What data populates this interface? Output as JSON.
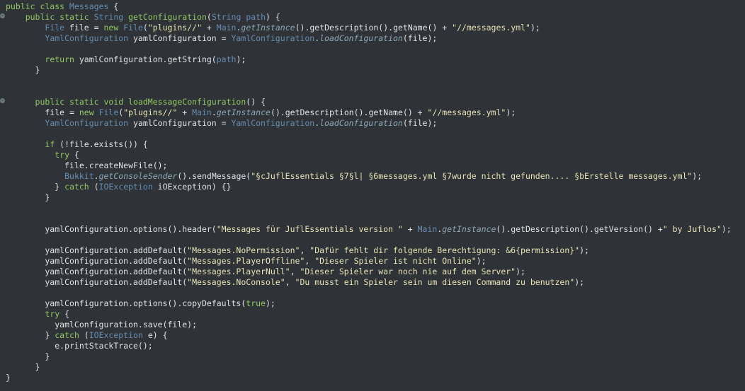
{
  "code_lines": [
    {
      "segments": [
        {
          "c": "k",
          "t": "public class "
        },
        {
          "c": "t",
          "t": "Messages"
        },
        {
          "c": "plain",
          "t": " {"
        }
      ]
    },
    {
      "segments": [
        {
          "c": "plain",
          "t": "    "
        },
        {
          "c": "k",
          "t": "public static "
        },
        {
          "c": "t",
          "t": "String"
        },
        {
          "c": "plain",
          "t": " "
        },
        {
          "c": "green",
          "t": "getConfiguration"
        },
        {
          "c": "plain",
          "t": "("
        },
        {
          "c": "t",
          "t": "String"
        },
        {
          "c": "plain",
          "t": " "
        },
        {
          "c": "cls",
          "t": "path"
        },
        {
          "c": "plain",
          "t": ") {"
        }
      ]
    },
    {
      "segments": [
        {
          "c": "plain",
          "t": "        "
        },
        {
          "c": "t",
          "t": "File"
        },
        {
          "c": "plain",
          "t": " file = "
        },
        {
          "c": "k",
          "t": "new "
        },
        {
          "c": "t",
          "t": "File"
        },
        {
          "c": "plain",
          "t": "("
        },
        {
          "c": "str-c",
          "t": "\"plugins//\""
        },
        {
          "c": "plain",
          "t": " + "
        },
        {
          "c": "t",
          "t": "Main"
        },
        {
          "c": "plain",
          "t": "."
        },
        {
          "c": "i",
          "t": "getInstance"
        },
        {
          "c": "plain",
          "t": "().getDescription().getName() + "
        },
        {
          "c": "str-c",
          "t": "\"//messages.yml\""
        },
        {
          "c": "plain",
          "t": ");"
        }
      ]
    },
    {
      "segments": [
        {
          "c": "plain",
          "t": "        "
        },
        {
          "c": "t",
          "t": "YamlConfiguration"
        },
        {
          "c": "plain",
          "t": " yamlConfiguration = "
        },
        {
          "c": "t",
          "t": "YamlConfiguration"
        },
        {
          "c": "plain",
          "t": "."
        },
        {
          "c": "i",
          "t": "loadConfiguration"
        },
        {
          "c": "plain",
          "t": "(file);"
        }
      ]
    },
    {
      "segments": []
    },
    {
      "segments": [
        {
          "c": "plain",
          "t": "        "
        },
        {
          "c": "k",
          "t": "return "
        },
        {
          "c": "plain",
          "t": "yamlConfiguration.getString("
        },
        {
          "c": "cls",
          "t": "path"
        },
        {
          "c": "plain",
          "t": ");"
        }
      ]
    },
    {
      "segments": [
        {
          "c": "plain",
          "t": "      }"
        }
      ]
    },
    {
      "segments": []
    },
    {
      "segments": []
    },
    {
      "segments": [
        {
          "c": "plain",
          "t": "      "
        },
        {
          "c": "k",
          "t": "public static void "
        },
        {
          "c": "green",
          "t": "loadMessageConfiguration"
        },
        {
          "c": "plain",
          "t": "() {"
        }
      ]
    },
    {
      "segments": [
        {
          "c": "plain",
          "t": "        "
        },
        {
          "c": "plain",
          "t": "file = "
        },
        {
          "c": "k",
          "t": "new "
        },
        {
          "c": "t",
          "t": "File"
        },
        {
          "c": "plain",
          "t": "("
        },
        {
          "c": "str-c",
          "t": "\"plugins//\""
        },
        {
          "c": "plain",
          "t": " + "
        },
        {
          "c": "t",
          "t": "Main"
        },
        {
          "c": "plain",
          "t": "."
        },
        {
          "c": "i",
          "t": "getInstance"
        },
        {
          "c": "plain",
          "t": "().getDescription().getName() + "
        },
        {
          "c": "str-c",
          "t": "\"//messages.yml\""
        },
        {
          "c": "plain",
          "t": ");"
        }
      ]
    },
    {
      "segments": [
        {
          "c": "plain",
          "t": "        "
        },
        {
          "c": "t",
          "t": "YamlConfiguration"
        },
        {
          "c": "plain",
          "t": " yamlConfiguration = "
        },
        {
          "c": "t",
          "t": "YamlConfiguration"
        },
        {
          "c": "plain",
          "t": "."
        },
        {
          "c": "i",
          "t": "loadConfiguration"
        },
        {
          "c": "plain",
          "t": "(file);"
        }
      ]
    },
    {
      "segments": []
    },
    {
      "segments": [
        {
          "c": "plain",
          "t": "        "
        },
        {
          "c": "k",
          "t": "if "
        },
        {
          "c": "plain",
          "t": "(!file.exists()) {"
        }
      ]
    },
    {
      "segments": [
        {
          "c": "plain",
          "t": "          "
        },
        {
          "c": "k",
          "t": "try "
        },
        {
          "c": "plain",
          "t": "{"
        }
      ]
    },
    {
      "segments": [
        {
          "c": "plain",
          "t": "            file.createNewFile();"
        }
      ]
    },
    {
      "segments": [
        {
          "c": "plain",
          "t": "            "
        },
        {
          "c": "t",
          "t": "Bukkit"
        },
        {
          "c": "plain",
          "t": "."
        },
        {
          "c": "i",
          "t": "getConsoleSender"
        },
        {
          "c": "plain",
          "t": "().sendMessage("
        },
        {
          "c": "str-c",
          "t": "\"§cJuflEssentials §7§l| §6messages.yml §7wurde nicht gefunden.... §bErstelle messages.yml\""
        },
        {
          "c": "plain",
          "t": ");"
        }
      ]
    },
    {
      "segments": [
        {
          "c": "plain",
          "t": "          } "
        },
        {
          "c": "k",
          "t": "catch "
        },
        {
          "c": "plain",
          "t": "("
        },
        {
          "c": "t",
          "t": "IOException"
        },
        {
          "c": "plain",
          "t": " iOException) {}"
        }
      ]
    },
    {
      "segments": [
        {
          "c": "plain",
          "t": "        }"
        }
      ]
    },
    {
      "segments": []
    },
    {
      "segments": []
    },
    {
      "segments": [
        {
          "c": "plain",
          "t": "        yamlConfiguration.options().header("
        },
        {
          "c": "str-c",
          "t": "\"Messages für JuflEssentials version \""
        },
        {
          "c": "plain",
          "t": " + "
        },
        {
          "c": "t",
          "t": "Main"
        },
        {
          "c": "plain",
          "t": "."
        },
        {
          "c": "i",
          "t": "getInstance"
        },
        {
          "c": "plain",
          "t": "().getDescription().getVersion() +"
        },
        {
          "c": "str-c",
          "t": "\" by Juflos\""
        },
        {
          "c": "plain",
          "t": ");"
        }
      ]
    },
    {
      "segments": []
    },
    {
      "segments": [
        {
          "c": "plain",
          "t": "        yamlConfiguration.addDefault("
        },
        {
          "c": "str-c",
          "t": "\"Messages.NoPermission\""
        },
        {
          "c": "plain",
          "t": ", "
        },
        {
          "c": "str-c",
          "t": "\"Dafür fehlt dir folgende Berechtigung: &6{permission}\""
        },
        {
          "c": "plain",
          "t": ");"
        }
      ]
    },
    {
      "segments": [
        {
          "c": "plain",
          "t": "        yamlConfiguration.addDefault("
        },
        {
          "c": "str-c",
          "t": "\"Messages.PlayerOffline\""
        },
        {
          "c": "plain",
          "t": ", "
        },
        {
          "c": "str-c",
          "t": "\"Dieser Spieler ist nicht Online\""
        },
        {
          "c": "plain",
          "t": ");"
        }
      ]
    },
    {
      "segments": [
        {
          "c": "plain",
          "t": "        yamlConfiguration.addDefault("
        },
        {
          "c": "str-c",
          "t": "\"Messages.PlayerNull\""
        },
        {
          "c": "plain",
          "t": ", "
        },
        {
          "c": "str-c",
          "t": "\"Dieser Spieler war noch nie auf dem Server\""
        },
        {
          "c": "plain",
          "t": ");"
        }
      ]
    },
    {
      "segments": [
        {
          "c": "plain",
          "t": "        yamlConfiguration.addDefault("
        },
        {
          "c": "str-c",
          "t": "\"Messages.NoConsole\""
        },
        {
          "c": "plain",
          "t": ", "
        },
        {
          "c": "str-c",
          "t": "\"Du musst ein Spieler sein um diesen Command zu benutzen\""
        },
        {
          "c": "plain",
          "t": ");"
        }
      ]
    },
    {
      "segments": []
    },
    {
      "segments": [
        {
          "c": "plain",
          "t": "        yamlConfiguration.options().copyDefaults("
        },
        {
          "c": "k",
          "t": "true"
        },
        {
          "c": "plain",
          "t": ");"
        }
      ]
    },
    {
      "segments": [
        {
          "c": "plain",
          "t": "        "
        },
        {
          "c": "k",
          "t": "try "
        },
        {
          "c": "plain",
          "t": "{"
        }
      ]
    },
    {
      "segments": [
        {
          "c": "plain",
          "t": "          yamlConfiguration.save(file);"
        }
      ]
    },
    {
      "segments": [
        {
          "c": "plain",
          "t": "        } "
        },
        {
          "c": "k",
          "t": "catch "
        },
        {
          "c": "plain",
          "t": "("
        },
        {
          "c": "t",
          "t": "IOException"
        },
        {
          "c": "plain",
          "t": " e) {"
        }
      ]
    },
    {
      "segments": [
        {
          "c": "plain",
          "t": "          e.printStackTrace();"
        }
      ]
    },
    {
      "segments": [
        {
          "c": "plain",
          "t": "        }"
        }
      ]
    },
    {
      "segments": [
        {
          "c": "plain",
          "t": "      }"
        }
      ]
    },
    {
      "segments": [
        {
          "c": "plain",
          "t": "}"
        }
      ]
    }
  ],
  "fold_marker_symbol": "−",
  "colors": {
    "background": "#2f3337",
    "keyword": "#93c763",
    "type": "#678cb1",
    "string": "#e8e2b7",
    "text": "#e0e2e4"
  }
}
